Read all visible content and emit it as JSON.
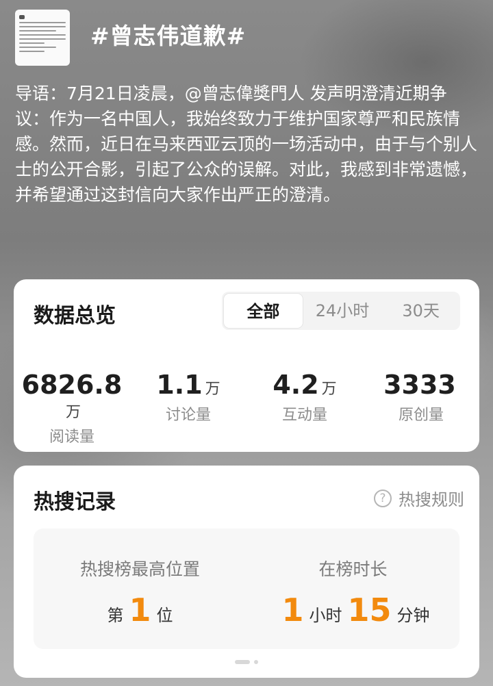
{
  "header": {
    "title": "#曾志伟道歉#"
  },
  "intro": {
    "text": "导语：7月21日凌晨，@曾志偉獎門人 发声明澄清近期争议：作为一名中国人，我始终致力于维护国家尊严和民族情感。然而，近日在马来西亚云顶的一场活动中，由于与个别人士的公开合影，引起了公众的误解。对此，我感到非常遗憾，并希望通过这封信向大家作出严正的澄清。"
  },
  "overview": {
    "title": "数据总览",
    "tabs": [
      "全部",
      "24小时",
      "30天"
    ],
    "stats": [
      {
        "value": "6826.8",
        "unit": "万",
        "label": "阅读量"
      },
      {
        "value": "1.1",
        "unit": "万",
        "label": "讨论量"
      },
      {
        "value": "4.2",
        "unit": "万",
        "label": "互动量"
      },
      {
        "value": "3333",
        "unit": "",
        "label": "原创量"
      }
    ]
  },
  "hot": {
    "title": "热搜记录",
    "rules_label": "热搜规则",
    "rules_icon": "?",
    "peak": {
      "label": "热搜榜最高位置",
      "prefix": "第",
      "value": "1",
      "suffix": "位"
    },
    "duration": {
      "label": "在榜时长",
      "hours": "1",
      "hours_unit": "小时",
      "minutes": "15",
      "minutes_unit": "分钟"
    }
  },
  "colors": {
    "accent": "#f28a0e"
  }
}
